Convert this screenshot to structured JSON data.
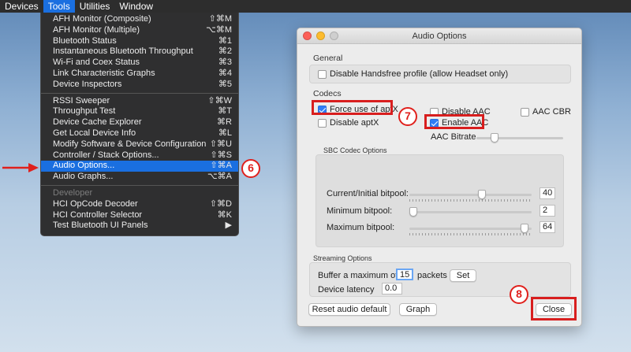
{
  "menubar": {
    "items": [
      "Devices",
      "Tools",
      "Utilities",
      "Window"
    ],
    "active_index": 1
  },
  "menu": {
    "items": [
      {
        "label": "AFH Monitor (Composite)",
        "shortcut": "⇧⌘M"
      },
      {
        "label": "AFH Monitor (Multiple)",
        "shortcut": "⌥⌘M"
      },
      {
        "label": "Bluetooth Status",
        "shortcut": "⌘1"
      },
      {
        "label": "Instantaneous Bluetooth Throughput",
        "shortcut": "⌘2"
      },
      {
        "label": "Wi-Fi and Coex Status",
        "shortcut": "⌘3"
      },
      {
        "label": "Link Characteristic Graphs",
        "shortcut": "⌘4"
      },
      {
        "label": "Device Inspectors",
        "shortcut": "⌘5"
      },
      {
        "label": "RSSI Sweeper",
        "shortcut": "⇧⌘W"
      },
      {
        "label": "Throughput Test",
        "shortcut": "⌘T"
      },
      {
        "label": "Device Cache Explorer",
        "shortcut": "⌘R"
      },
      {
        "label": "Get Local Device Info",
        "shortcut": "⌘L"
      },
      {
        "label": "Modify Software & Device Configuration",
        "shortcut": "⇧⌘U"
      },
      {
        "label": "Controller / Stack Options...",
        "shortcut": "⇧⌘S"
      },
      {
        "label": "Audio Options...",
        "shortcut": "⇧⌘A"
      },
      {
        "label": "Audio Graphs...",
        "shortcut": "⌥⌘A"
      },
      {
        "label": "Developer",
        "shortcut": ""
      },
      {
        "label": "HCI OpCode Decoder",
        "shortcut": "⇧⌘D"
      },
      {
        "label": "HCI Controller Selector",
        "shortcut": "⌘K"
      },
      {
        "label": "Test Bluetooth UI Panels",
        "shortcut": "▶"
      }
    ]
  },
  "annotations": {
    "step6": "6",
    "step7": "7",
    "step8": "8",
    "accent": "#e0201c"
  },
  "window": {
    "title": "Audio Options",
    "general": {
      "title": "General",
      "disable_handsfree": {
        "label": "Disable Handsfree profile (allow Headset only)",
        "checked": false
      }
    },
    "codecs": {
      "title": "Codecs",
      "force_aptx": {
        "label": "Force use of aptX",
        "checked": true
      },
      "disable_aptx": {
        "label": "Disable aptX",
        "checked": false
      },
      "disable_aac": {
        "label": "Disable AAC",
        "checked": false
      },
      "enable_aac": {
        "label": "Enable AAC",
        "checked": true
      },
      "aac_cbr": {
        "label": "AAC CBR",
        "checked": false
      },
      "aac_bitrate_label": "AAC Bitrate",
      "aac_bitrate_fraction": 0.18
    },
    "sbc": {
      "title": "SBC Codec Options",
      "current": {
        "label": "Current/Initial bitpool:",
        "value": "40",
        "fraction": 0.6
      },
      "minimum": {
        "label": "Minimum bitpool:",
        "value": "2",
        "fraction": 0.0
      },
      "maximum": {
        "label": "Maximum bitpool:",
        "value": "64",
        "fraction": 0.97
      }
    },
    "streaming": {
      "title": "Streaming Options",
      "buffer_label": "Buffer a maximum of",
      "buffer_value": "15",
      "packets_label": "packets",
      "set_label": "Set",
      "latency_label": "Device latency",
      "latency_value": "0.0"
    },
    "buttons": {
      "reset": "Reset audio default",
      "graph": "Graph",
      "close": "Close"
    }
  }
}
